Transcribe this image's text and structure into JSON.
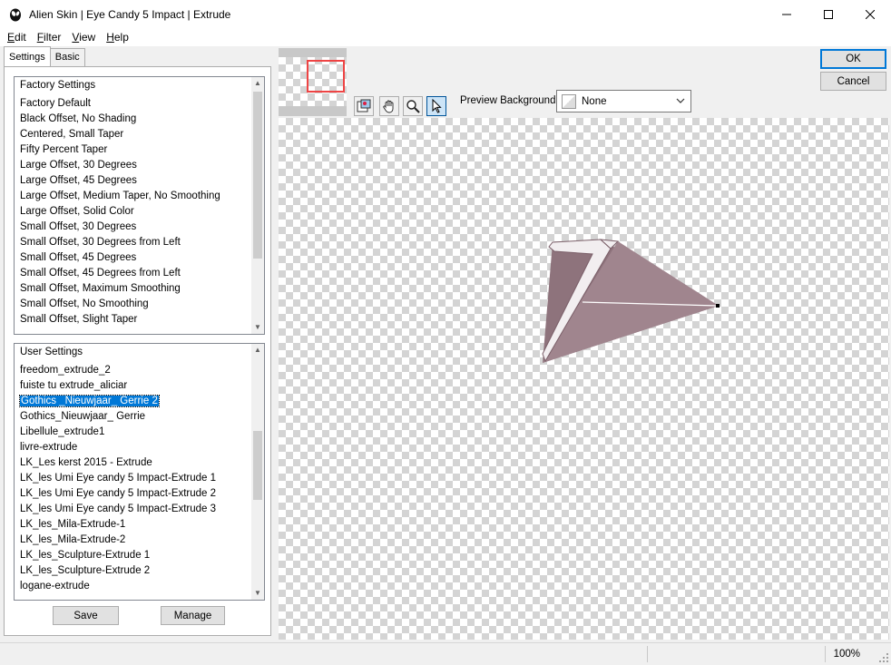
{
  "window": {
    "title": "Alien Skin | Eye Candy 5 Impact | Extrude",
    "controls": {
      "minimize": "—",
      "maximize": "☐",
      "close": "✕"
    }
  },
  "menu": [
    {
      "accel": "E",
      "rest": "dit"
    },
    {
      "accel": "F",
      "rest": "ilter"
    },
    {
      "accel": "V",
      "rest": "iew"
    },
    {
      "accel": "H",
      "rest": "elp"
    }
  ],
  "tabs": {
    "settings": "Settings",
    "basic": "Basic"
  },
  "factory": {
    "header": "Factory Settings",
    "items": [
      "Factory Default",
      "Black Offset, No Shading",
      "Centered, Small Taper",
      "Fifty Percent Taper",
      "Large Offset, 30 Degrees",
      "Large Offset, 45 Degrees",
      "Large Offset, Medium Taper, No Smoothing",
      "Large Offset, Solid Color",
      "Small Offset, 30 Degrees",
      "Small Offset, 30 Degrees from Left",
      "Small Offset, 45 Degrees",
      "Small Offset, 45 Degrees from Left",
      "Small Offset, Maximum Smoothing",
      "Small Offset, No Smoothing",
      "Small Offset, Slight Taper"
    ]
  },
  "user": {
    "header": "User Settings",
    "items": [
      "freedom_extrude_2",
      "fuiste tu extrude_aliciar",
      "Gothics _Nieuwjaar_ Gerrie 2",
      "Gothics_Nieuwjaar_ Gerrie",
      "Libellule_extrude1",
      "livre-extrude",
      "LK_Les kerst 2015 - Extrude",
      "LK_les Umi Eye candy 5 Impact-Extrude 1",
      "LK_les Umi Eye candy 5 Impact-Extrude 2",
      "LK_les Umi Eye candy 5 Impact-Extrude 3",
      "LK_les_Mila-Extrude-1",
      "LK_les_Mila-Extrude-2",
      "LK_les_Sculpture-Extrude 1",
      "LK_les_Sculpture-Extrude 2",
      "logane-extrude"
    ],
    "selected_item": "Gothics _Nieuwjaar_ Gerrie 2"
  },
  "buttons": {
    "save": "Save",
    "manage": "Manage",
    "ok": "OK",
    "cancel": "Cancel"
  },
  "preview": {
    "background_label": "Preview Background:",
    "background_value": "None",
    "shape_color": "#a0858e",
    "shape_dark_color": "#8e737c",
    "face_color": "#f2eef0"
  },
  "tools": [
    "navigator-icon",
    "hand-icon",
    "zoom-icon",
    "select-arrow-icon"
  ],
  "status": {
    "zoom": "100%"
  },
  "colors": {
    "selection": "#0078d7",
    "default_button_border": "#0078d7"
  }
}
